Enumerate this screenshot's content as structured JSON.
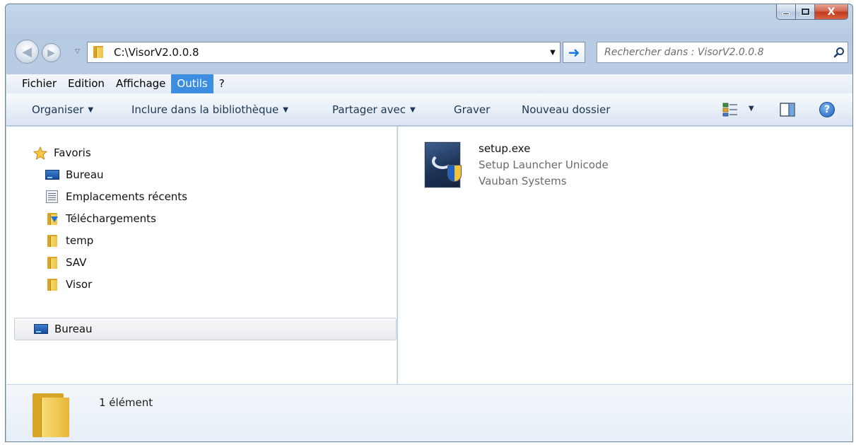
{
  "window": {
    "close_glyph": "X"
  },
  "address": {
    "path": "C:\\VisorV2.0.0.8"
  },
  "search": {
    "placeholder": "Rechercher dans : VisorV2.0.0.8"
  },
  "menu": {
    "items": [
      "Fichier",
      "Edition",
      "Affichage",
      "Outils",
      "?"
    ],
    "active": "Outils"
  },
  "toolbar": {
    "organize": "Organiser",
    "include_library": "Inclure dans la bibliothèque",
    "share_with": "Partager avec",
    "burn": "Graver",
    "new_folder": "Nouveau dossier",
    "help_glyph": "?"
  },
  "nav_pane": {
    "favorites_label": "Favoris",
    "favorites": [
      "Bureau",
      "Emplacements récents",
      "Téléchargements",
      "temp",
      "SAV",
      "Visor"
    ],
    "root_label": "Bureau"
  },
  "files": [
    {
      "name": "setup.exe",
      "description": "Setup Launcher Unicode",
      "company": "Vauban Systems"
    }
  ],
  "status": {
    "item_count": "1 élément"
  },
  "colors": {
    "menu_active": "#3d8ee0",
    "go_arrow": "#1c7ad8",
    "close_button": "#c2381e"
  },
  "icons": {
    "favorites": "star-icon",
    "desktop": "desktop-icon",
    "recent": "recent-places-icon",
    "downloads": "downloads-folder-icon",
    "folder": "folder-icon",
    "exe": "setup-exe-icon",
    "help": "help-icon"
  }
}
